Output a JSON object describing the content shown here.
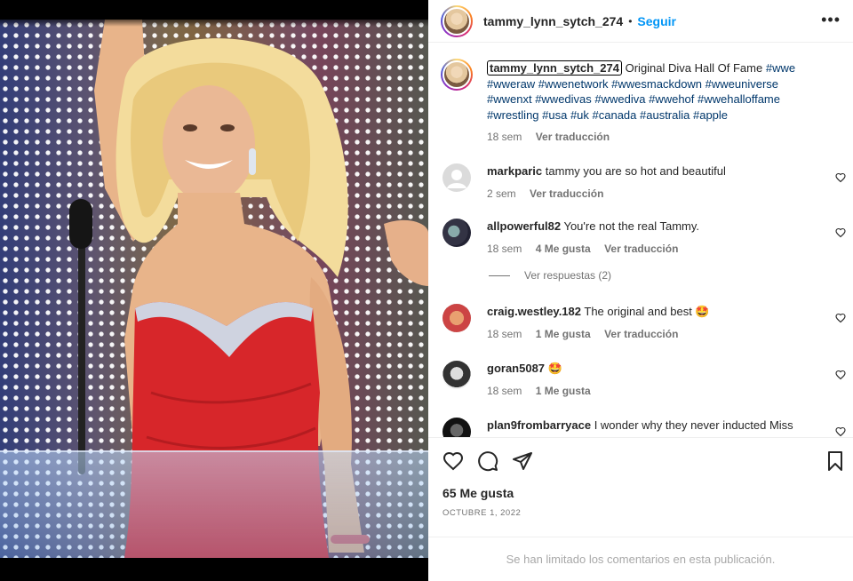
{
  "header": {
    "username": "tammy_lynn_sytch_274",
    "separator": "•",
    "follow_label": "Seguir",
    "more_label": "•••"
  },
  "caption": {
    "username": "tammy_lynn_sytch_274",
    "text_start": "Original Diva Hall Of Fame",
    "hashtags_line1": "#wwe",
    "hashtags_line2": "#wweraw #wwenetwork #wwesmackdown #wweuniverse",
    "hashtags_line3": "#wwenxt #wwedivas #wwediva #wwehof #wwehalloffame",
    "hashtags_line4": "#wrestling #usa #uk #canada #australia #apple",
    "time": "18 sem",
    "translate": "Ver traducción"
  },
  "comments": [
    {
      "username": "markparic",
      "text": "tammy you are so hot and beautiful",
      "time": "2 sem",
      "likes": "",
      "translate": "Ver traducción"
    },
    {
      "username": "allpowerful82",
      "text": "You're not the real Tammy.",
      "time": "18 sem",
      "likes": "4 Me gusta",
      "translate": "Ver traducción"
    },
    {
      "username": "craig.westley.182",
      "text": "The original and best 🤩",
      "time": "18 sem",
      "likes": "1 Me gusta",
      "translate": "Ver traducción"
    },
    {
      "username": "goran5087",
      "text": "🤩",
      "time": "18 sem",
      "likes": "1 Me gusta",
      "translate": ""
    },
    {
      "username": "plan9frombarryace",
      "text": "I wonder why they never inducted Miss",
      "time": "",
      "likes": "",
      "translate": ""
    }
  ],
  "view_replies": "Ver respuestas (2)",
  "post": {
    "likes": "65 Me gusta",
    "date": "OCTUBRE 1, 2022",
    "comments_limited": "Se han limitado los comentarios en esta publicación."
  },
  "colors": {
    "accent": "#0095f6",
    "hashtag": "#00376b",
    "muted": "#737373",
    "dress": "#d7262a"
  }
}
